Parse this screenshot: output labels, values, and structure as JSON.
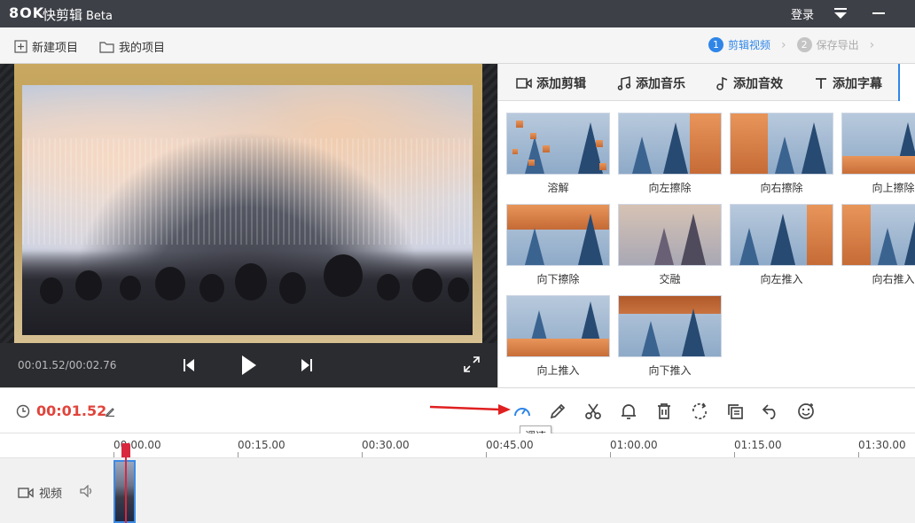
{
  "app": {
    "logo": "8OK",
    "name": "快剪辑",
    "badge": "Beta",
    "login_label": "登录"
  },
  "projects": {
    "new_project": "新建项目",
    "my_projects": "我的项目"
  },
  "steps": [
    {
      "num": "1",
      "label": "剪辑视频"
    },
    {
      "num": "2",
      "label": "保存导出"
    }
  ],
  "preview": {
    "time": "00:01.52/00:02.76"
  },
  "tabs": [
    "添加剪辑",
    "添加音乐",
    "添加音效",
    "添加字幕"
  ],
  "transitions": [
    "溶解",
    "向左擦除",
    "向右擦除",
    "向上擦除",
    "向下擦除",
    "交融",
    "向左推入",
    "向右推入",
    "向上推入",
    "向下推入"
  ],
  "toolbar": {
    "current_time": "00:01.52",
    "tooltip": "调速"
  },
  "timeline": {
    "ticks": [
      "00:00.00",
      "00:15.00",
      "00:30.00",
      "00:45.00",
      "01:00.00",
      "01:15.00",
      "01:30.00"
    ],
    "track_label": "视频"
  },
  "colors": {
    "accent": "#2f86e8",
    "time_red": "#e0453c",
    "playhead": "#d8283f"
  }
}
